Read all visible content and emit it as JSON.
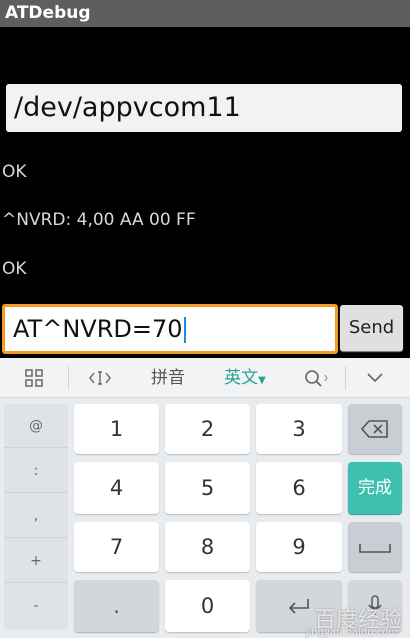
{
  "app": {
    "title": "ATDebug"
  },
  "device_path": "/dev/appvcom11",
  "log": [
    "OK",
    "^NVRD: 4,00 AA 00 FF",
    "OK"
  ],
  "command": {
    "value": "AT^NVRD=70"
  },
  "send_label": "Send",
  "ime_toolbar": {
    "pinyin": "拼音",
    "english": "英文"
  },
  "keyboard": {
    "side": [
      "@",
      ":",
      ",",
      "+",
      "-"
    ],
    "digits": [
      "1",
      "2",
      "3",
      "4",
      "5",
      "6",
      "7",
      "8",
      "9",
      "0"
    ],
    "dot": ".",
    "done": "完成"
  },
  "watermark": {
    "main": "百度经验",
    "sub": "jingyan.baidu.com"
  },
  "colors": {
    "accent": "#f59a23",
    "done": "#3fbfb0",
    "ime_active": "#2aa198"
  }
}
